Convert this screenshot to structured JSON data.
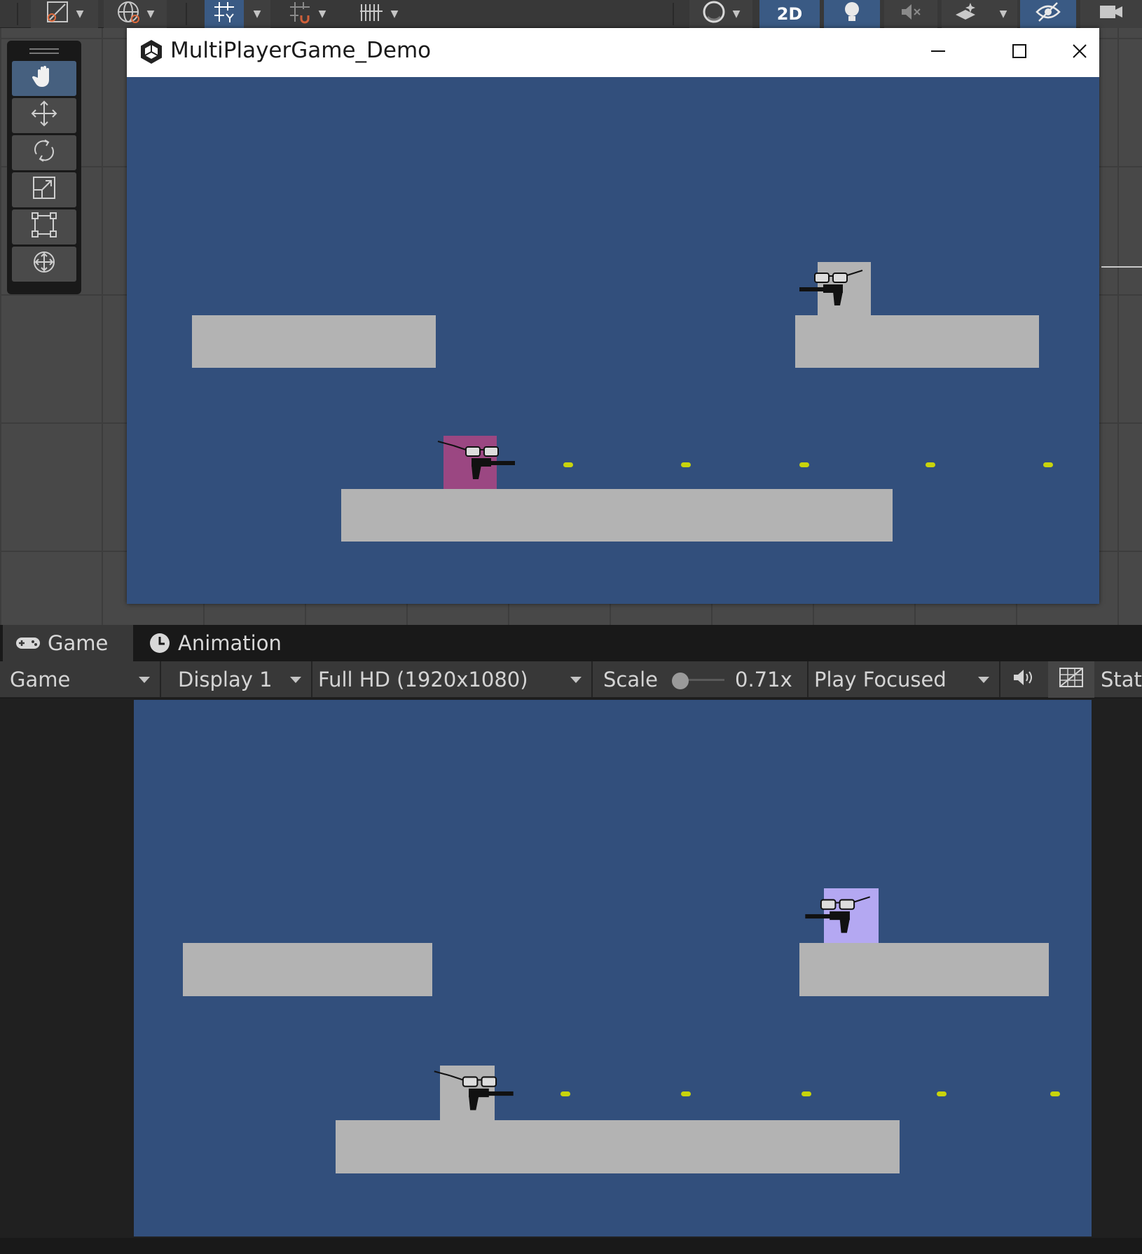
{
  "window": {
    "title": "MultiPlayerGame_Demo",
    "controls": [
      "minimize",
      "maximize",
      "close"
    ]
  },
  "scene_toolbar": {
    "buttons": [
      {
        "name": "draw-mode",
        "icon": "draw-mode-icon"
      },
      {
        "name": "global-toggle",
        "icon": "globe-icon"
      },
      {
        "name": "grid-snapping",
        "icon": "grid-snap-icon"
      },
      {
        "name": "increment-snap",
        "icon": "snap-magnet-icon"
      },
      {
        "name": "grid-visibility",
        "icon": "grid-icon"
      },
      {
        "name": "shading-mode",
        "icon": "sphere-icon"
      },
      {
        "name": "2d-toggle",
        "label": "2D"
      },
      {
        "name": "lighting-toggle",
        "icon": "light-bulb-icon"
      },
      {
        "name": "audio-toggle",
        "icon": "audio-mute-icon"
      },
      {
        "name": "effects-toggle",
        "icon": "effects-icon"
      },
      {
        "name": "scene-visibility",
        "icon": "eye-hidden-icon"
      },
      {
        "name": "camera-settings",
        "icon": "camera-icon"
      }
    ],
    "twod_label": "2D"
  },
  "tools": [
    {
      "name": "hand-tool",
      "icon": "hand-icon",
      "active": true
    },
    {
      "name": "move-tool",
      "icon": "move-icon"
    },
    {
      "name": "rotate-tool",
      "icon": "rotate-icon"
    },
    {
      "name": "scale-tool",
      "icon": "scale-icon"
    },
    {
      "name": "rect-tool",
      "icon": "rect-icon"
    },
    {
      "name": "transform-tool",
      "icon": "transform-icon"
    }
  ],
  "tabs": [
    {
      "label": "Game",
      "icon": "gamepad-icon",
      "active": true
    },
    {
      "label": "Animation",
      "icon": "clock-icon",
      "active": false
    }
  ],
  "game_toolbar": {
    "view_mode": "Game",
    "display": "Display 1",
    "resolution": "Full HD (1920x1080)",
    "scale_label": "Scale",
    "scale_value": "0.71x",
    "play_mode": "Play Focused",
    "audio_icon": "speaker-icon",
    "gizmos_icon": "gizmos-grid-icon",
    "stats_label": "Stat"
  },
  "colors": {
    "game_background": "#324f7c",
    "platform": "#b3b3b3",
    "bullet": "#c8d40c",
    "player_magenta": "#9b4782",
    "player_gray": "#b3b3b3",
    "player_lavender": "#b4a8f2",
    "editor_dark": "#383838",
    "active_blue": "#3a5a84"
  },
  "scenes": [
    {
      "id": "build-window",
      "players": [
        {
          "color": "#b3b3b3",
          "facing": "left"
        },
        {
          "color": "#9b4782",
          "facing": "right"
        }
      ],
      "platform_count": 3,
      "bullet_count": 5
    },
    {
      "id": "editor-game-view",
      "players": [
        {
          "color": "#b4a8f2",
          "facing": "left"
        },
        {
          "color": "#b3b3b3",
          "facing": "right"
        }
      ],
      "platform_count": 3,
      "bullet_count": 5
    }
  ]
}
